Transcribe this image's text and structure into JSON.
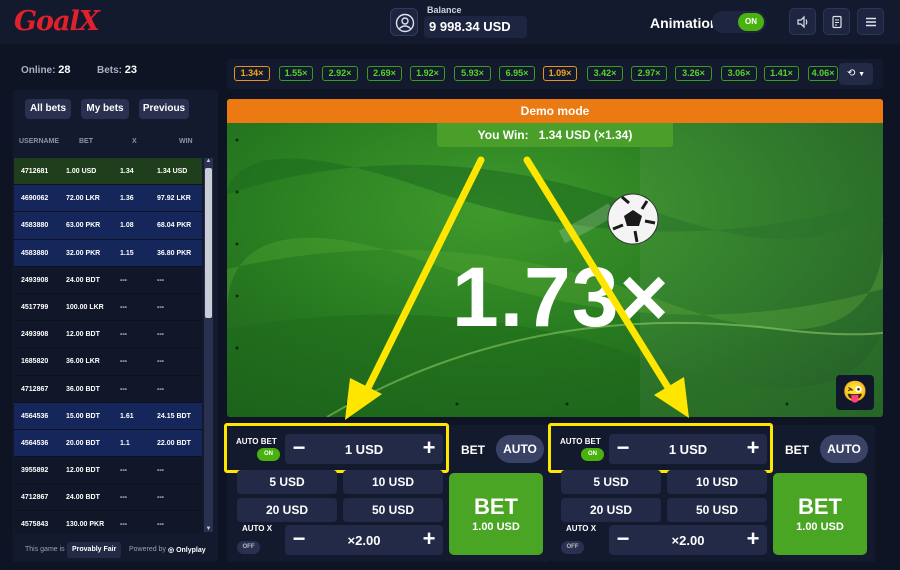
{
  "header": {
    "logo": "GoalX",
    "balance_label": "Balance",
    "balance_value": "9 998.34 USD",
    "animation_label": "Animation",
    "animation_toggle": "ON"
  },
  "sidebar": {
    "online_label": "Online:",
    "online_count": "28",
    "bets_label": "Bets:",
    "bets_count": "23",
    "tabs": [
      "All bets",
      "My bets",
      "Previous"
    ],
    "columns": [
      "USERNAME",
      "BET",
      "X",
      "WIN"
    ],
    "rows": [
      {
        "user": "4712681",
        "bet": "1.00 USD",
        "x": "1.34",
        "win": "1.34 USD",
        "status": "win"
      },
      {
        "user": "4690062",
        "bet": "72.00 LKR",
        "x": "1.36",
        "win": "97.92 LKR",
        "status": "cashout"
      },
      {
        "user": "4583880",
        "bet": "63.00 PKR",
        "x": "1.08",
        "win": "68.04 PKR",
        "status": "cashout"
      },
      {
        "user": "4583880",
        "bet": "32.00 PKR",
        "x": "1.15",
        "win": "36.80 PKR",
        "status": "cashout"
      },
      {
        "user": "2493908",
        "bet": "24.00 BDT",
        "x": "---",
        "win": "---",
        "status": "pending"
      },
      {
        "user": "4517799",
        "bet": "100.00 LKR",
        "x": "---",
        "win": "---",
        "status": "pending"
      },
      {
        "user": "2493908",
        "bet": "12.00 BDT",
        "x": "---",
        "win": "---",
        "status": "pending"
      },
      {
        "user": "1685820",
        "bet": "36.00 LKR",
        "x": "---",
        "win": "---",
        "status": "pending"
      },
      {
        "user": "4712867",
        "bet": "36.00 BDT",
        "x": "---",
        "win": "---",
        "status": "pending"
      },
      {
        "user": "4564536",
        "bet": "15.00 BDT",
        "x": "1.61",
        "win": "24.15 BDT",
        "status": "cashout"
      },
      {
        "user": "4564536",
        "bet": "20.00 BDT",
        "x": "1.1",
        "win": "22.00 BDT",
        "status": "cashout"
      },
      {
        "user": "3955892",
        "bet": "12.00 BDT",
        "x": "---",
        "win": "---",
        "status": "pending"
      },
      {
        "user": "4712867",
        "bet": "24.00 BDT",
        "x": "---",
        "win": "---",
        "status": "pending"
      },
      {
        "user": "4575843",
        "bet": "130.00 PKR",
        "x": "---",
        "win": "---",
        "status": "pending"
      }
    ],
    "footer_text": "This game is",
    "provably_fair": "Provably Fair",
    "powered_by": "Powered by",
    "provider": "Onlyplay"
  },
  "history": [
    "1.34×",
    "1.55×",
    "2.92×",
    "2.69×",
    "1.92×",
    "5.93×",
    "6.95×",
    "1.09×",
    "3.42×",
    "2.97×",
    "3.26×",
    "3.06×",
    "1.41×",
    "4.06×"
  ],
  "history_highlight": [
    0,
    7
  ],
  "game": {
    "demo_label": "Demo mode",
    "you_win_label": "You Win:",
    "you_win_value": "1.34 USD (×1.34)",
    "multiplier": "1.73×"
  },
  "bet_panels": [
    {
      "auto_bet_label": "AUTO BET",
      "auto_bet_toggle": "ON",
      "amount": "1 USD",
      "quick": [
        "5 USD",
        "10 USD",
        "20 USD",
        "50 USD"
      ],
      "bet_tab": "BET",
      "auto_tab": "AUTO",
      "auto_x_label": "AUTO X",
      "auto_x_toggle": "OFF",
      "auto_x_value": "×2.00",
      "bet_button": "BET",
      "bet_button_amount": "1.00 USD"
    },
    {
      "auto_bet_label": "AUTO BET",
      "auto_bet_toggle": "ON",
      "amount": "1 USD",
      "quick": [
        "5 USD",
        "10 USD",
        "20 USD",
        "50 USD"
      ],
      "bet_tab": "BET",
      "auto_tab": "AUTO",
      "auto_x_label": "AUTO X",
      "auto_x_toggle": "OFF",
      "auto_x_value": "×2.00",
      "bet_button": "BET",
      "bet_button_amount": "1.00 USD"
    }
  ],
  "colors": {
    "background": "#0f1424",
    "panel": "#141a2e",
    "accent_green": "#49b20f",
    "accent_orange": "#ec7a12",
    "annotation_yellow": "#ffe600"
  }
}
